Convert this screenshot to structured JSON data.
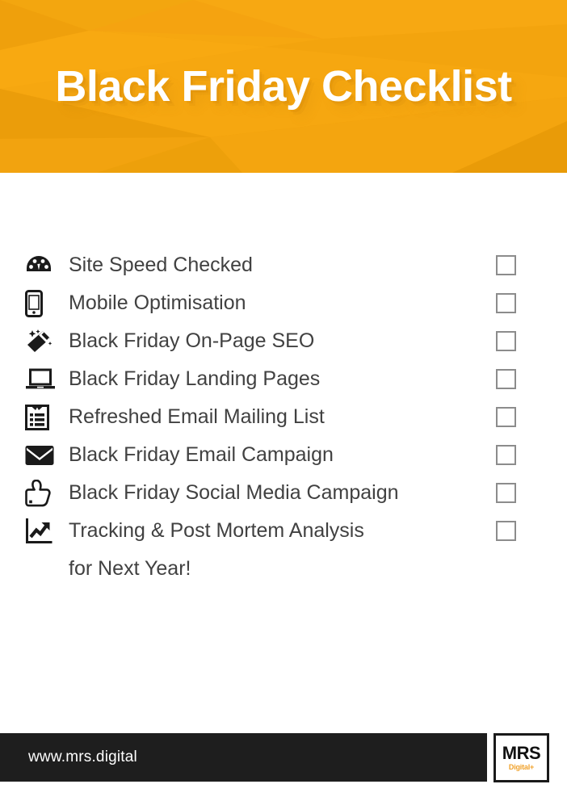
{
  "header": {
    "title": "Black Friday Checklist",
    "background_color": "#f5a310",
    "title_color": "#ffffff"
  },
  "checklist": {
    "items": [
      {
        "icon": "speedometer-icon",
        "label": "Site Speed Checked",
        "checked": false
      },
      {
        "icon": "mobile-phone-icon",
        "label": "Mobile Optimisation",
        "checked": false
      },
      {
        "icon": "magic-wand-icon",
        "label": "Black Friday On-Page SEO",
        "checked": false
      },
      {
        "icon": "laptop-icon",
        "label": "Black Friday Landing Pages",
        "checked": false
      },
      {
        "icon": "clipboard-list-icon",
        "label": "Refreshed Email Mailing List",
        "checked": false
      },
      {
        "icon": "envelope-icon",
        "label": "Black Friday Email Campaign",
        "checked": false
      },
      {
        "icon": "thumbs-up-icon",
        "label": "Black Friday Social Media Campaign",
        "checked": false
      },
      {
        "icon": "growth-chart-icon",
        "label": "Tracking & Post Mortem Analysis",
        "checked": false
      }
    ],
    "continuation_line": "for Next Year!",
    "label_color": "#414141",
    "checkbox_border_color": "#8c8c8c"
  },
  "footer": {
    "url": "www.mrs.digital",
    "bar_color": "#1e1e1e",
    "url_color": "#ffffff",
    "logo": {
      "primary": "MRS",
      "secondary": "Digital",
      "plus": "+",
      "primary_color": "#111111",
      "secondary_color": "#f0a12a"
    }
  }
}
